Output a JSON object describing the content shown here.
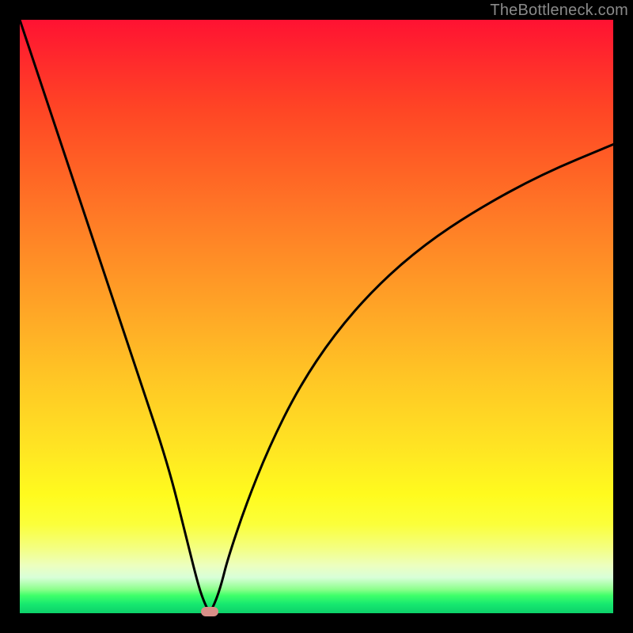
{
  "watermark": "TheBottleneck.com",
  "chart_data": {
    "type": "line",
    "title": "",
    "xlabel": "",
    "ylabel": "",
    "xlim": [
      0,
      100
    ],
    "ylim": [
      0,
      100
    ],
    "gradient_stops": [
      {
        "pct": 0,
        "color": "#ff1232"
      },
      {
        "pct": 8,
        "color": "#ff2e2b"
      },
      {
        "pct": 15,
        "color": "#ff4525"
      },
      {
        "pct": 25,
        "color": "#ff6225"
      },
      {
        "pct": 35,
        "color": "#ff7f26"
      },
      {
        "pct": 48,
        "color": "#ffa326"
      },
      {
        "pct": 60,
        "color": "#ffc525"
      },
      {
        "pct": 72,
        "color": "#ffe423"
      },
      {
        "pct": 80,
        "color": "#fffb1e"
      },
      {
        "pct": 85,
        "color": "#fbff3a"
      },
      {
        "pct": 89,
        "color": "#f4ff81"
      },
      {
        "pct": 92,
        "color": "#ecffc0"
      },
      {
        "pct": 94,
        "color": "#d8ffd8"
      },
      {
        "pct": 96,
        "color": "#8cff8c"
      },
      {
        "pct": 97,
        "color": "#40ff6a"
      },
      {
        "pct": 98.5,
        "color": "#16e86f"
      },
      {
        "pct": 100,
        "color": "#0dd16a"
      }
    ],
    "series": [
      {
        "name": "bottleneck-curve",
        "x": [
          0,
          5,
          10,
          15,
          20,
          25,
          28,
          30,
          31,
          32,
          33,
          34,
          35,
          38,
          42,
          47,
          53,
          60,
          68,
          77,
          88,
          100
        ],
        "y": [
          100,
          85,
          70,
          55,
          40,
          25,
          13,
          5,
          2,
          0,
          2,
          5,
          9,
          18,
          28,
          38,
          47,
          55,
          62,
          68,
          74,
          79
        ]
      }
    ],
    "marker": {
      "x": 32,
      "y": 0,
      "color": "#d98f88"
    }
  }
}
